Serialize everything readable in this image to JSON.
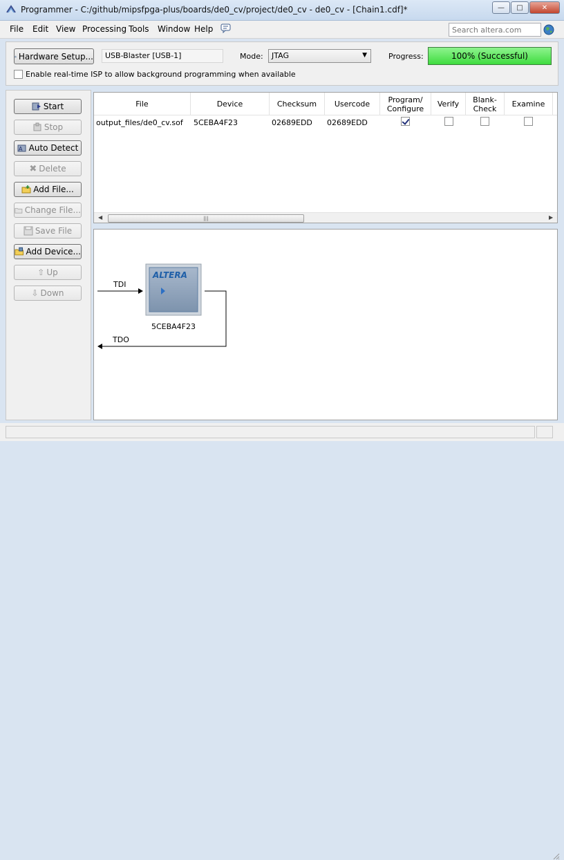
{
  "window": {
    "title": "Programmer - C:/github/mipsfpga-plus/boards/de0_cv/project/de0_cv - de0_cv - [Chain1.cdf]*",
    "minimize_icon": "minimize-icon",
    "maximize_icon": "maximize-icon",
    "close_icon": "close-icon"
  },
  "menu": {
    "items": [
      "File",
      "Edit",
      "View",
      "Processing",
      "Tools",
      "Window",
      "Help"
    ],
    "search_placeholder": "Search altera.com"
  },
  "toolbar": {
    "hardware_setup_label": "Hardware Setup...",
    "hardware_value": "USB-Blaster [USB-1]",
    "mode_label": "Mode:",
    "mode_value": "JTAG",
    "progress_label": "Progress:",
    "progress_percent": 100,
    "progress_text": "100% (Successful)",
    "isp_label": "Enable real-time ISP to allow background programming when available",
    "isp_checked": false
  },
  "side_buttons": [
    {
      "label": "Start",
      "enabled": true,
      "icon": "start-icon"
    },
    {
      "label": "Stop",
      "enabled": false,
      "icon": "stop-icon"
    },
    {
      "label": "Auto Detect",
      "enabled": true,
      "icon": "auto-detect-icon"
    },
    {
      "label": "Delete",
      "enabled": false,
      "icon": "delete-icon"
    },
    {
      "label": "Add File...",
      "enabled": true,
      "icon": "add-file-icon"
    },
    {
      "label": "Change File...",
      "enabled": false,
      "icon": "change-file-icon"
    },
    {
      "label": "Save File",
      "enabled": false,
      "icon": "save-file-icon"
    },
    {
      "label": "Add Device...",
      "enabled": true,
      "icon": "add-device-icon"
    },
    {
      "label": "Up",
      "enabled": false,
      "icon": "up-icon"
    },
    {
      "label": "Down",
      "enabled": false,
      "icon": "down-icon"
    }
  ],
  "table": {
    "columns": [
      "File",
      "Device",
      "Checksum",
      "Usercode",
      "Program/ Configure",
      "Verify",
      "Blank- Check",
      "Examine"
    ],
    "rows": [
      {
        "file": "output_files/de0_cv.sof",
        "device": "5CEBA4F23",
        "checksum": "02689EDD",
        "usercode": "02689EDD",
        "program": true,
        "verify": false,
        "blank_check": false,
        "examine": false
      }
    ]
  },
  "chain": {
    "tdi_label": "TDI",
    "tdo_label": "TDO",
    "chip_logo": "ALTERA",
    "device_label": "5CEBA4F23"
  },
  "colors": {
    "progress_green": "#3fdc3f",
    "window_frame": "#d9e4f1",
    "chip_blue": "#6b8fb5"
  }
}
